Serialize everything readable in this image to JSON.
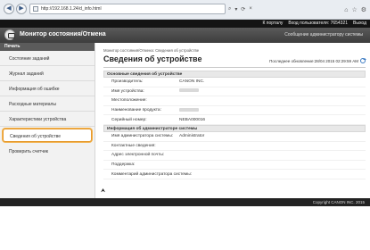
{
  "browser": {
    "url": "http://192.168.1.24/d_info.html",
    "back_glyph": "◀",
    "forward_glyph": "▶"
  },
  "topbar": {
    "portal_link": "К порталу",
    "login_user_label": "Вход пользователя:",
    "user_id": "7654321",
    "logout_link": "Выход"
  },
  "header": {
    "title": "Монитор состояния/Отмена",
    "admin_message": "Сообщение администратору системы"
  },
  "sidebar": {
    "heading": "Печать",
    "items": [
      {
        "label": "Состояние заданий"
      },
      {
        "label": "Журнал заданий"
      },
      {
        "label": "Информация об ошибке"
      },
      {
        "label": "Расходные материалы"
      },
      {
        "label": "Характеристики устройства"
      },
      {
        "label": "Сведения об устройстве"
      },
      {
        "label": "Проверить счетчик"
      }
    ]
  },
  "main": {
    "breadcrumb": "Монитор состояния/Отмена: Сведения об устройстве",
    "title": "Сведения об устройстве",
    "last_update": "Последнее обновление:28/04 2015 02:29:59 AM",
    "basic_section": {
      "heading": "Основные сведения об устройстве",
      "rows": [
        {
          "label": "Производитель:",
          "value": "CANON INC."
        },
        {
          "label": "Имя устройства:",
          "value": ""
        },
        {
          "label": "Местоположение:",
          "value": ""
        },
        {
          "label": "Наименование продукта:",
          "value": ""
        },
        {
          "label": "Серийный номер:",
          "value": "NEBA000016"
        }
      ]
    },
    "admin_section": {
      "heading": "Информация об администраторе системы",
      "rows": [
        {
          "label": "Имя администратора системы:",
          "value": "Administrator"
        },
        {
          "label": "Контактные сведения:",
          "value": ""
        },
        {
          "label": "Адрес электронной почты:",
          "value": ""
        },
        {
          "label": "Поддержка:",
          "value": ""
        },
        {
          "label": "Комментарий администратора системы:",
          "value": ""
        }
      ]
    },
    "back_to_top_glyph": "⮝"
  },
  "footer": {
    "copyright": "Copyright CANON INC. 2015"
  }
}
